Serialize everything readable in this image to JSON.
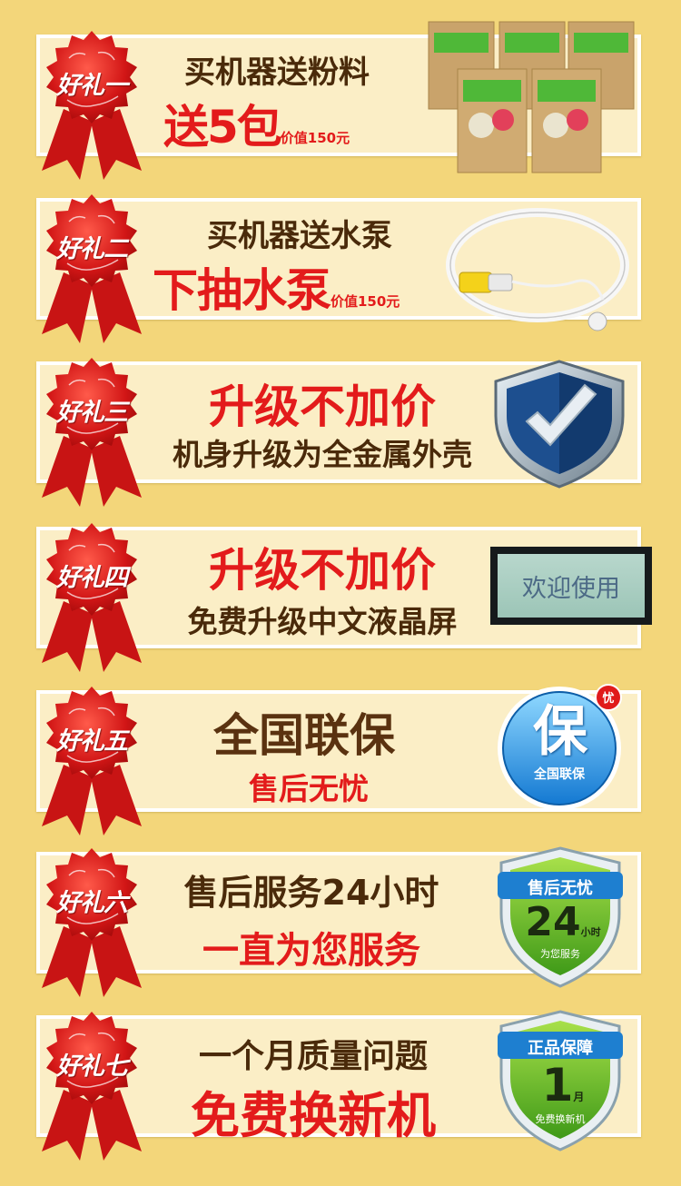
{
  "gifts": [
    {
      "badge": "好礼一",
      "line1": "买机器送粉料",
      "line2_big": "送5包",
      "line2_small": "价值150元",
      "icon": "powder-packs-icon"
    },
    {
      "badge": "好礼二",
      "line1": "买机器送水泵",
      "line2_big": "下抽水泵",
      "line2_small": "价值150元",
      "icon": "water-pump-icon"
    },
    {
      "badge": "好礼三",
      "line1": "升级不加价",
      "line2": "机身升级为全金属外壳",
      "icon": "shield-check-icon"
    },
    {
      "badge": "好礼四",
      "line1": "升级不加价",
      "line2": "免费升级中文液晶屏",
      "icon": "lcd-screen-icon",
      "screen_text": "欢迎使用"
    },
    {
      "badge": "好礼五",
      "line1": "全国联保",
      "line2": "售后无忧",
      "icon": "warranty-badge-icon",
      "seal_char": "保",
      "seal_label": "全国联保",
      "seal_corner": "忧"
    },
    {
      "badge": "好礼六",
      "line1": "售后服务24小时",
      "line2": "一直为您服务",
      "icon": "service-shield-icon",
      "shield_top": "售后无忧",
      "shield_num": "24",
      "shield_unit": "小时",
      "shield_bottom": "为您服务"
    },
    {
      "badge": "好礼七",
      "line1": "一个月质量问题",
      "line2": "免费换新机",
      "icon": "genuine-shield-icon",
      "shield_top": "正品保障",
      "shield_num": "1",
      "shield_unit": "月",
      "shield_bottom": "免费换新机"
    }
  ],
  "colors": {
    "background": "#f3d67a",
    "card": "#fbeec6",
    "ribbon_red": "#d81e1e",
    "text_brown": "#4a2a0a",
    "text_red": "#e31b1b"
  }
}
